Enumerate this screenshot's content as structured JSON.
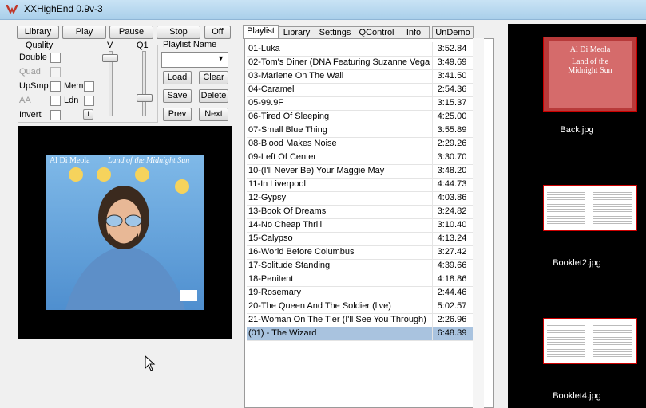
{
  "window": {
    "title": "XXHighEnd 0.9v-3"
  },
  "transport": {
    "library": "Library",
    "play": "Play",
    "pause": "Pause",
    "stop": "Stop",
    "off": "Off"
  },
  "quality": {
    "group_label": "Quality",
    "double": "Double",
    "quad": "Quad",
    "upsmp": "UpSmp",
    "mem": "Mem",
    "aa": "AA",
    "ldn": "Ldn",
    "invert": "Invert",
    "info_button": "i"
  },
  "sliders": {
    "v_label": "V",
    "q1_label": "Q1"
  },
  "playlist_panel": {
    "name_label": "Playlist Name",
    "name_value": "",
    "load": "Load",
    "clear": "Clear",
    "save": "Save",
    "delete": "Delete",
    "prev": "Prev",
    "next": "Next"
  },
  "album": {
    "artist": "Al Di Meola",
    "title": "Land of the Midnight Sun"
  },
  "tabs": [
    {
      "label": "Playlist",
      "active": true
    },
    {
      "label": "Library"
    },
    {
      "label": "Settings"
    },
    {
      "label": "QControl"
    },
    {
      "label": "Info"
    },
    {
      "label": "UnDemo"
    }
  ],
  "tracks": [
    {
      "name": "01-Luka",
      "duration": "3:52.84"
    },
    {
      "name": "02-Tom's Diner (DNA Featuring Suzanne Vega",
      "duration": "3:49.69"
    },
    {
      "name": "03-Marlene On The Wall",
      "duration": "3:41.50"
    },
    {
      "name": "04-Caramel",
      "duration": "2:54.36"
    },
    {
      "name": "05-99.9F",
      "duration": "3:15.37"
    },
    {
      "name": "06-Tired Of Sleeping",
      "duration": "4:25.00"
    },
    {
      "name": "07-Small Blue Thing",
      "duration": "3:55.89"
    },
    {
      "name": "08-Blood Makes Noise",
      "duration": "2:29.26"
    },
    {
      "name": "09-Left Of Center",
      "duration": "3:30.70"
    },
    {
      "name": "10-(I'll Never Be) Your Maggie May",
      "duration": "3:48.20"
    },
    {
      "name": "11-In Liverpool",
      "duration": "4:44.73"
    },
    {
      "name": "12-Gypsy",
      "duration": "4:03.86"
    },
    {
      "name": "13-Book Of Dreams",
      "duration": "3:24.82"
    },
    {
      "name": "14-No Cheap Thrill",
      "duration": "3:10.40"
    },
    {
      "name": "15-Calypso",
      "duration": "4:13.24"
    },
    {
      "name": "16-World Before Columbus",
      "duration": "3:27.42"
    },
    {
      "name": "17-Solitude Standing",
      "duration": "4:39.66"
    },
    {
      "name": "18-Penitent",
      "duration": "4:18.86"
    },
    {
      "name": "19-Rosemary",
      "duration": "2:44.46"
    },
    {
      "name": "20-The Queen And The Soldier (live)",
      "duration": "5:02.57"
    },
    {
      "name": "21-Woman On The Tier (I'll See You Through)",
      "duration": "2:26.96"
    },
    {
      "name": "(01) - The Wizard",
      "duration": "6:48.39",
      "selected": true
    }
  ],
  "thumbnails": [
    {
      "caption": "Back.jpg",
      "artist": "Al Di Meola",
      "title": "Land of the Midnight Sun"
    },
    {
      "caption": "Booklet2.jpg"
    },
    {
      "caption": "Booklet4.jpg"
    }
  ],
  "colors": {
    "titlebar": "#b9d9f0",
    "selection": "#a9c3df",
    "thumb_border": "#cc0000",
    "album_bg": "#000000"
  }
}
